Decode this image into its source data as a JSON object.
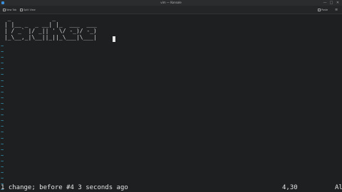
{
  "window": {
    "title": "vim — Konsole",
    "minimize_glyph": "—",
    "maximize_glyph": "□",
    "close_glyph": "✕"
  },
  "toolbar": {
    "new_tab_label": "New Tab",
    "split_view_label": "Split View",
    "paste_label": "Paste",
    "menu_glyph": "≡"
  },
  "editor": {
    "ascii_art": "  _            _               \n | |__ _  _ __| |_  ___  ___  \n | / _` |/ _|| ' \\/ -_)/ -_) \n |_\\__,_|\\__||_||_\\___|\\___| ",
    "tilde_lines": "~\n~\n~\n~\n~\n~\n~\n~\n~\n~\n~\n~\n~\n~\n~\n~\n~\n~\n~\n~\n~\n~\n~\n~\n~\n~",
    "colors": {
      "background": "#1d1f21",
      "text": "#d6d6d6",
      "tilde": "#3aa7c9"
    }
  },
  "statusline": {
    "message": "1 change; before #4  3 seconds ago",
    "position": "4,30",
    "scroll": "Al"
  }
}
